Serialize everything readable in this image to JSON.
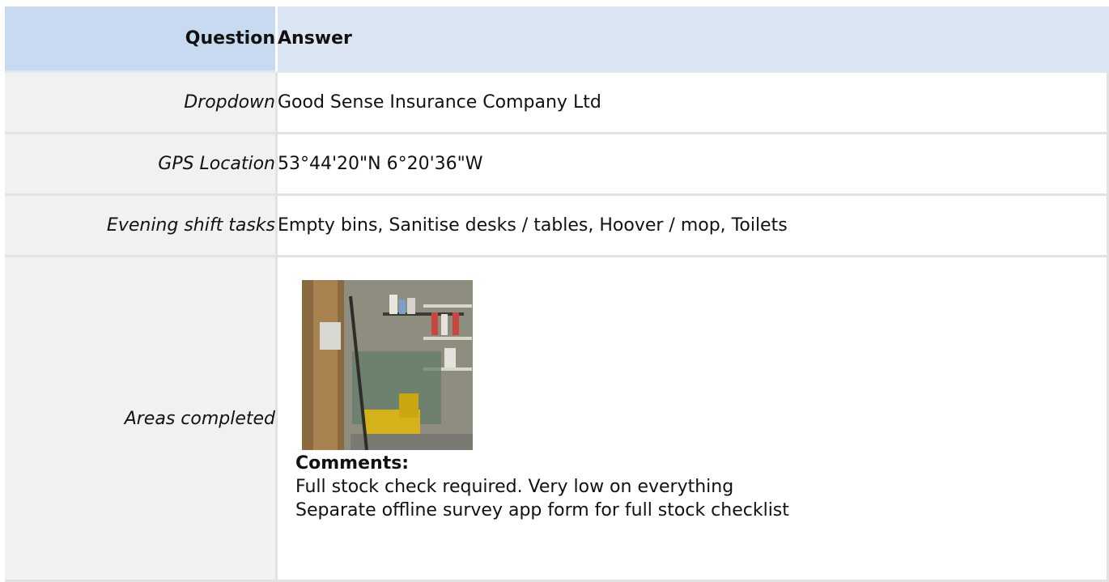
{
  "header": {
    "question": "Question",
    "answer": "Answer"
  },
  "rows": [
    {
      "question": "Dropdown",
      "answer": "Good Sense Insurance Company Ltd"
    },
    {
      "question": "GPS Location",
      "answer": "53°44'20\"N 6°20'36\"W"
    },
    {
      "question": "Evening shift tasks",
      "answer": "Empty bins, Sanitise desks / tables, Hoover / mop, Toilets"
    }
  ],
  "photo_row": {
    "question": "Areas completed",
    "comments_label": "Comments:",
    "comments": [
      "Full stock check required. Very low on everything",
      "Separate offline survey app form for full stock checklist"
    ]
  }
}
